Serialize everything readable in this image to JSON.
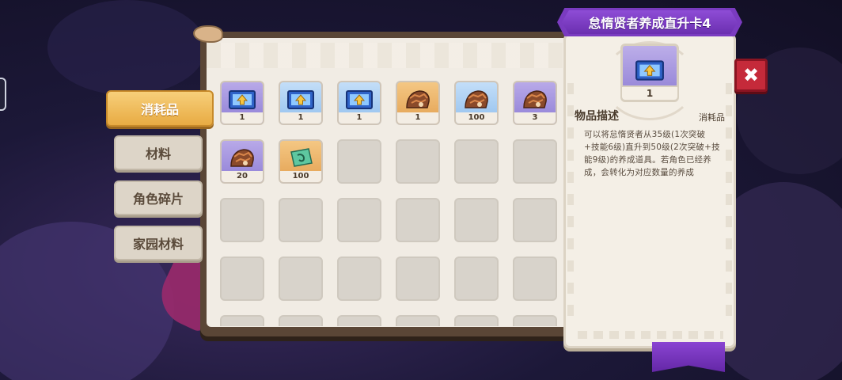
{
  "tabs": [
    {
      "label": "消耗品",
      "active": true
    },
    {
      "label": "材料",
      "active": false
    },
    {
      "label": "角色碎片",
      "active": false
    },
    {
      "label": "家园材料",
      "active": false
    }
  ],
  "items": [
    {
      "icon": "upgrade-card-icon",
      "bg": "purple",
      "qty": "1",
      "selected": true
    },
    {
      "icon": "upgrade-card-icon",
      "bg": "blue",
      "qty": "1",
      "selected": false
    },
    {
      "icon": "upgrade-card-icon",
      "bg": "blue",
      "qty": "1",
      "selected": false
    },
    {
      "icon": "character-fragment-icon",
      "bg": "gold",
      "qty": "1",
      "selected": false
    },
    {
      "icon": "character-fragment-icon",
      "bg": "blue",
      "qty": "100",
      "selected": false
    },
    {
      "icon": "character-fragment-icon",
      "bg": "purple",
      "qty": "3",
      "selected": false
    },
    {
      "icon": "character-fragment-icon",
      "bg": "purple",
      "qty": "20",
      "selected": false
    },
    {
      "icon": "green-ticket-icon",
      "bg": "gold",
      "qty": "100",
      "selected": false
    }
  ],
  "empty_slot_count": 22,
  "detail": {
    "title": "怠惰贤者养成直升卡4",
    "preview_qty": "1",
    "desc_label": "物品描述",
    "category": "消耗品",
    "description": "可以将怠惰贤者从35级(1次突破+技能6级)直升到50级(2次突破+技能9级)的养成道具。若角色已经养成，会转化为对应数量的养成"
  },
  "close_label": "✖",
  "colors": {
    "accent_gold": "#e8ab43",
    "banner_purple": "#7a3bc0",
    "close_red": "#c52a3a"
  }
}
